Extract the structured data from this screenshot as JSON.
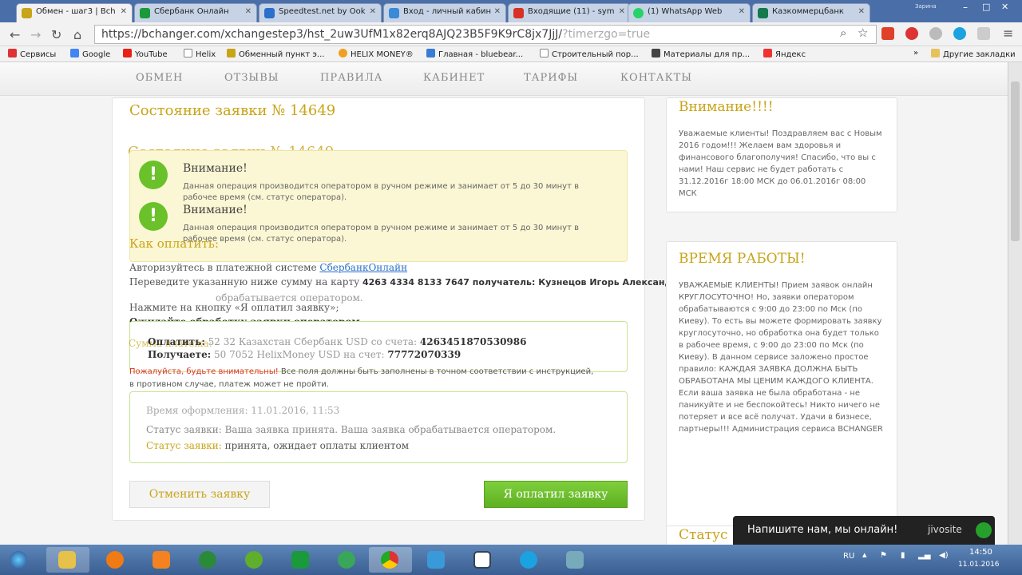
{
  "browser": {
    "tabs": [
      {
        "label": "Обмен - шаг3 | Bch",
        "color": "#c8a417",
        "active": true
      },
      {
        "label": "Сбербанк Онлайн",
        "color": "#1a9a3a",
        "active": false
      },
      {
        "label": "Speedtest.net by Ook",
        "color": "#2a6fc9",
        "active": false
      },
      {
        "label": "Вход - личный кабин",
        "color": "#3a8ad6",
        "active": false
      },
      {
        "label": "Входящие (11) - sym",
        "color": "#d93025",
        "active": false
      },
      {
        "label": "(1) WhatsApp Web",
        "color": "#25d366",
        "active": false
      },
      {
        "label": "Казкоммерцбанк",
        "color": "#127a4c",
        "active": false
      }
    ],
    "window_user": "Зарина",
    "url_main": "https://bchanger.com/xchangestep3/hst_2uw3UfM1x82erq8AJQ23B5F9K9rC8jx7JjJ/",
    "url_dim": "?timerzgo=true",
    "bookmarks": [
      {
        "label": "Сервисы",
        "color": "#d33"
      },
      {
        "label": "Google",
        "color": "#4285f4"
      },
      {
        "label": "YouTube",
        "color": "#e62117"
      },
      {
        "label": "Helix",
        "color": "#888"
      },
      {
        "label": "Обменный пункт э...",
        "color": "#c8a417"
      },
      {
        "label": "HELIX MONEY®",
        "color": "#f0a020"
      },
      {
        "label": "Главная - bluebear...",
        "color": "#3a7bd5"
      },
      {
        "label": "Строительный пор...",
        "color": "#888"
      },
      {
        "label": "Материалы для пр...",
        "color": "#444"
      },
      {
        "label": "Яндекс",
        "color": "#e33"
      }
    ],
    "other_bookmarks": "Другие закладки"
  },
  "site": {
    "nav": [
      "ОБМЕН",
      "ОТЗЫВЫ",
      "ПРАВИЛА",
      "КАБИНЕТ",
      "ТАРИФЫ",
      "КОНТАКТЫ"
    ],
    "title": "Состояние заявки № 14649",
    "warning_title": "Внимание!",
    "warning_text": "Данная операция производится оператором в ручном режиме и занимает от 5 до 30 минут в рабочее время (см. статус оператора).",
    "how_to_pay": "Как оплатить:",
    "step1_prefix": "Авторизуйтесь в платежной системе ",
    "step1_link": "СбербанкОнлайн",
    "step2_prefix": "Переведите указанную ниже сумму на карту ",
    "step2_bold": "4263 4334 8133 7647 получатель: Кузнецов Игорь Александрович",
    "step3": "Нажмите на кнопку «Я оплатил заявку»;",
    "step4": "Ожидайте обработку заявки оператором.",
    "overlay_processing": "обрабатывается оператором.",
    "amount_label": "Сумма платежа:",
    "pay_label": "Оплатить:",
    "pay_value": "52 32 Казахстан Сбербанк USD со счета: ",
    "pay_account": "4263451870530986",
    "get_label": "Получаете:",
    "get_value": "50 7052 HelixMoney USD на счет: ",
    "get_account": "77772070339",
    "caution_red": "Пожалуйста, будьте внимательны!",
    "caution_text": " Все поля должны быть заполнены в точном соответствии с инструкцией,",
    "caution_text2": "в противном случае, платеж может не пройти.",
    "created_label": "Время оформления:",
    "created_value": "11.01.2016, 11:53",
    "status_label": "Статус заявки:",
    "status_value": "принята, ожидает оплаты клиентом",
    "status2_text": "Статус заявки: Ваша заявка принята. Ваша заявка обрабатывается оператором.",
    "cancel_button": "Отменить заявку",
    "paid_button": "Я оплатил заявку"
  },
  "sidebar": {
    "attention_title": "Внимание!!!!",
    "attention_text": "Уважаемые клиенты! Поздравляем вас с Новым 2016 годом!!! Желаем вам здоровья и финансового благополучия! Спасибо, что вы с нами! Наш сервис не будет работать с 31.12.2016г 18:00 МСК до 06.01.2016г 08:00 МСК",
    "hours_title": "ВРЕМЯ РАБОТЫ!",
    "hours_text": "УВАЖАЕМЫЕ КЛИЕНТЫ! Прием заявок онлайн КРУГЛОСУТОЧНО! Но, заявки оператором обрабатываются с 9:00 до 23:00 по Мск (по Киеву). То есть вы можете формировать заявку круглосуточно, но обработка она будет только в рабочее время, с 9:00 до 23:00 по Мск (по Киеву). В данном сервисе заложено простое правило: КАЖДАЯ ЗАЯВКА ДОЛЖНА БЫТЬ ОБРАБОТАНА МЫ ЦЕНИМ КАЖДОГО КЛИЕНТА. Если ваша заявка не была обработана - не паникуйте и не беспокойтесь! Никто ничего не потеряет и все всё получат. Удачи в бизнесе, партнеры!!! Администрация сервиса BCHANGER",
    "status_title": "Статус"
  },
  "chat": {
    "text": "Напишите нам, мы онлайн!",
    "brand": "jivosite"
  },
  "taskbar": {
    "lang": "RU",
    "time": "14:50",
    "date": "11.01.2016",
    "apps": [
      "start",
      "explorer",
      "avast",
      "vlc",
      "globe",
      "utorrent",
      "a-app",
      "at-app",
      "chrome",
      "app-blue",
      "calc",
      "skype",
      "tool"
    ]
  }
}
